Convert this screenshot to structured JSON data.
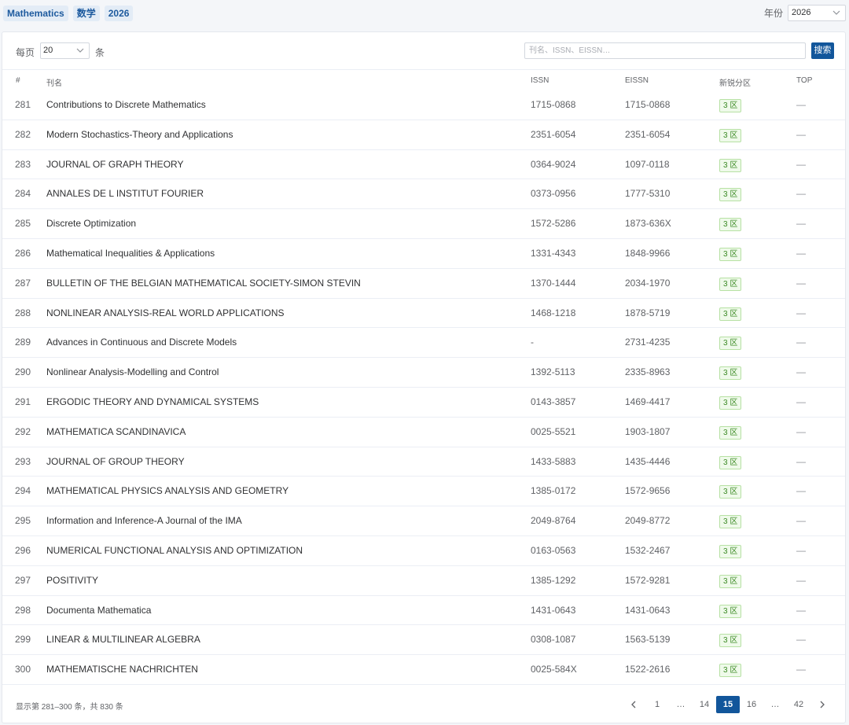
{
  "header": {
    "tags": [
      "Mathematics",
      "数学",
      "2026"
    ],
    "year_label": "年份",
    "year_value": "2026"
  },
  "toolbar": {
    "page_size_label": "每页",
    "page_size_value": "20",
    "page_size_unit": "条",
    "search_placeholder": "刊名、ISSN、EISSN…",
    "search_button": "搜索"
  },
  "table": {
    "columns": [
      "#",
      "刊名",
      "ISSN",
      "EISSN",
      "新锐分区",
      "TOP"
    ],
    "rows": [
      {
        "num": "281",
        "name": "Contributions to Discrete Mathematics",
        "issn": "1715-0868",
        "eissn": "1715-0868",
        "zone": "3 区",
        "top": "—"
      },
      {
        "num": "282",
        "name": "Modern Stochastics-Theory and Applications",
        "issn": "2351-6054",
        "eissn": "2351-6054",
        "zone": "3 区",
        "top": "—"
      },
      {
        "num": "283",
        "name": "JOURNAL OF GRAPH THEORY",
        "issn": "0364-9024",
        "eissn": "1097-0118",
        "zone": "3 区",
        "top": "—"
      },
      {
        "num": "284",
        "name": "ANNALES DE L INSTITUT FOURIER",
        "issn": "0373-0956",
        "eissn": "1777-5310",
        "zone": "3 区",
        "top": "—"
      },
      {
        "num": "285",
        "name": "Discrete Optimization",
        "issn": "1572-5286",
        "eissn": "1873-636X",
        "zone": "3 区",
        "top": "—"
      },
      {
        "num": "286",
        "name": "Mathematical Inequalities & Applications",
        "issn": "1331-4343",
        "eissn": "1848-9966",
        "zone": "3 区",
        "top": "—"
      },
      {
        "num": "287",
        "name": "BULLETIN OF THE BELGIAN MATHEMATICAL SOCIETY-SIMON STEVIN",
        "issn": "1370-1444",
        "eissn": "2034-1970",
        "zone": "3 区",
        "top": "—"
      },
      {
        "num": "288",
        "name": "NONLINEAR ANALYSIS-REAL WORLD APPLICATIONS",
        "issn": "1468-1218",
        "eissn": "1878-5719",
        "zone": "3 区",
        "top": "—"
      },
      {
        "num": "289",
        "name": "Advances in Continuous and Discrete Models",
        "issn": "-",
        "eissn": "2731-4235",
        "zone": "3 区",
        "top": "—"
      },
      {
        "num": "290",
        "name": "Nonlinear Analysis-Modelling and Control",
        "issn": "1392-5113",
        "eissn": "2335-8963",
        "zone": "3 区",
        "top": "—"
      },
      {
        "num": "291",
        "name": "ERGODIC THEORY AND DYNAMICAL SYSTEMS",
        "issn": "0143-3857",
        "eissn": "1469-4417",
        "zone": "3 区",
        "top": "—"
      },
      {
        "num": "292",
        "name": "MATHEMATICA SCANDINAVICA",
        "issn": "0025-5521",
        "eissn": "1903-1807",
        "zone": "3 区",
        "top": "—"
      },
      {
        "num": "293",
        "name": "JOURNAL OF GROUP THEORY",
        "issn": "1433-5883",
        "eissn": "1435-4446",
        "zone": "3 区",
        "top": "—"
      },
      {
        "num": "294",
        "name": "MATHEMATICAL PHYSICS ANALYSIS AND GEOMETRY",
        "issn": "1385-0172",
        "eissn": "1572-9656",
        "zone": "3 区",
        "top": "—"
      },
      {
        "num": "295",
        "name": "Information and Inference-A Journal of the IMA",
        "issn": "2049-8764",
        "eissn": "2049-8772",
        "zone": "3 区",
        "top": "—"
      },
      {
        "num": "296",
        "name": "NUMERICAL FUNCTIONAL ANALYSIS AND OPTIMIZATION",
        "issn": "0163-0563",
        "eissn": "1532-2467",
        "zone": "3 区",
        "top": "—"
      },
      {
        "num": "297",
        "name": "POSITIVITY",
        "issn": "1385-1292",
        "eissn": "1572-9281",
        "zone": "3 区",
        "top": "—"
      },
      {
        "num": "298",
        "name": "Documenta Mathematica",
        "issn": "1431-0643",
        "eissn": "1431-0643",
        "zone": "3 区",
        "top": "—"
      },
      {
        "num": "299",
        "name": "LINEAR & MULTILINEAR ALGEBRA",
        "issn": "0308-1087",
        "eissn": "1563-5139",
        "zone": "3 区",
        "top": "—"
      },
      {
        "num": "300",
        "name": "MATHEMATISCHE NACHRICHTEN",
        "issn": "0025-584X",
        "eissn": "1522-2616",
        "zone": "3 区",
        "top": "—"
      }
    ]
  },
  "footer": {
    "summary": "显示第 281–300 条，共 830 条",
    "pages": [
      "1",
      "…",
      "14",
      "15",
      "16",
      "…",
      "42"
    ],
    "active_page": "15",
    "prev_icon": "chevron-left-icon",
    "next_icon": "chevron-right-icon"
  },
  "colors": {
    "accent": "#12569b",
    "tag_bg": "#e3ecf6",
    "badge_green": "#3b8a24",
    "badge_green_bg": "#effaea"
  }
}
